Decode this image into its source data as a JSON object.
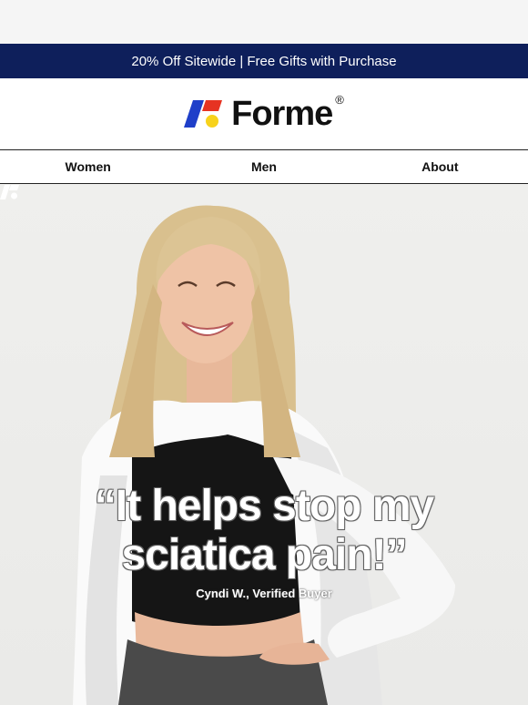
{
  "promo": {
    "text": "20% Off Sitewide | Free Gifts with Purchase"
  },
  "brand": {
    "name": "Forme",
    "reg": "®",
    "colors": {
      "blue": "#1f3fc9",
      "red": "#e63322",
      "yellow": "#f7d21c",
      "navy": "#0e1f5b"
    }
  },
  "nav": {
    "items": [
      {
        "label": "Women"
      },
      {
        "label": "Men"
      },
      {
        "label": "About"
      }
    ]
  },
  "hero": {
    "quote_line1": "“It helps stop my",
    "quote_line2": "sciatica pain!”",
    "attribution": "Cyndi W., Verified Buyer"
  }
}
